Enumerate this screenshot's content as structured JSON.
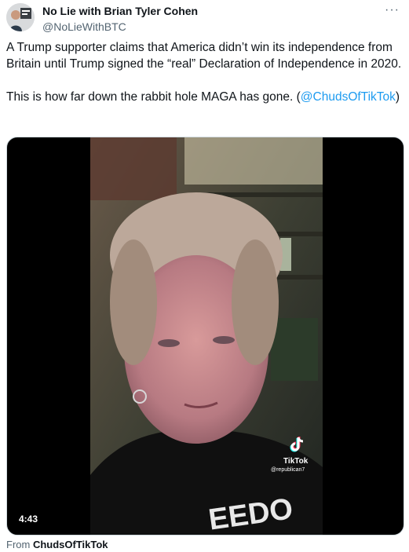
{
  "author": {
    "display_name": "No Lie with Brian Tyler Cohen",
    "handle": "@NoLieWithBTC",
    "avatar_icon": "person-avatar-icon"
  },
  "menu": {
    "label": "···"
  },
  "tweet": {
    "text_main": "A Trump supporter claims that America didn’t win its independence from Britain until Trump signed the “real” Declaration of Independence in 2020.",
    "text_second_prefix": "This is how far down the rabbit hole MAGA has gone. (",
    "text_second_link": "@ChudsOfTikTok",
    "text_second_suffix": ")"
  },
  "media": {
    "duration": "4:43",
    "watermark_brand": "TikTok",
    "watermark_user": "@republican7",
    "play_icon": "tiktok-logo-icon"
  },
  "source": {
    "prefix": "From ",
    "name": "ChudsOfTikTok"
  },
  "colors": {
    "link": "#1d9bf0",
    "secondary_text": "#536471",
    "primary_text": "#0f1419"
  }
}
